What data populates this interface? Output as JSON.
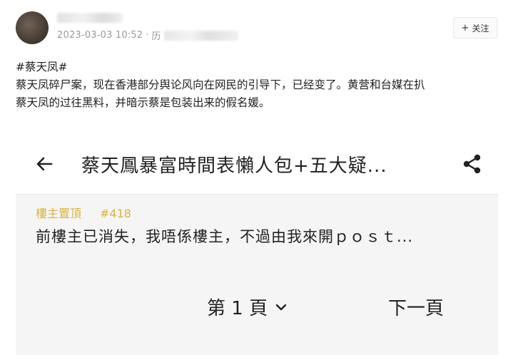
{
  "author": {
    "date": "2023-03-03 10:52",
    "separator": "·",
    "source_partial": "历"
  },
  "follow_button": {
    "label": "关注",
    "icon": "plus-icon"
  },
  "post": {
    "hashtag": "#蔡天凤#",
    "body_line1": "蔡天凤碎尸案，现在香港部分舆论风向在网民的引导下，已经变了。黄营和台媒在扒",
    "body_line2": "蔡天凤的过往黑料，并暗示蔡是包装出来的假名媛。"
  },
  "embedded_screenshot": {
    "back_icon": "arrow-left-icon",
    "title": "蔡天鳳暴富時間表懶人包+五大疑...",
    "share_icon": "share-icon",
    "op_badge": "樓主置頂",
    "floor_number": "#418",
    "reply_text": "前樓主已消失，我唔係樓主，不過由我來開ｐｏｓｔ...",
    "page_label": "第 1 頁",
    "next_page_label": "下一頁"
  },
  "colors": {
    "op_badge": "#d7b24a",
    "meta_text": "#9a9a9a",
    "embed_background": "#f5f5f5"
  }
}
